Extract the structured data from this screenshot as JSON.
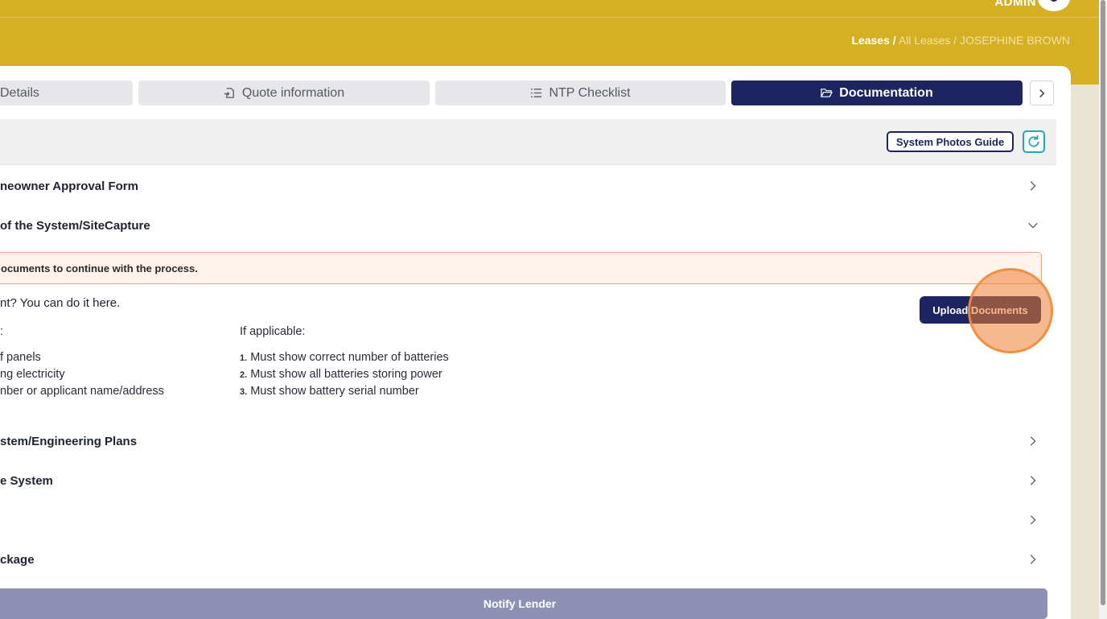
{
  "header": {
    "user_label": "ADMIN",
    "breadcrumb": {
      "root": "Leases /",
      "middle": "All Leases /",
      "current": "JOSEPHINE BROWN"
    }
  },
  "tabs": [
    {
      "label": "Details",
      "icon": "details-icon",
      "active": false
    },
    {
      "label": "Quote information",
      "icon": "file-import-icon",
      "active": false
    },
    {
      "label": "NTP Checklist",
      "icon": "list-icon",
      "active": false
    },
    {
      "label": "Documentation",
      "icon": "folder-open-icon",
      "active": true
    }
  ],
  "toolbar": {
    "photos_guide_label": "System Photos Guide",
    "refresh_icon": "refresh-icon"
  },
  "sections": [
    {
      "label": "neowner Approval Form",
      "expanded": false
    },
    {
      "label": "of the System/SiteCapture",
      "expanded": true
    },
    {
      "label": "stem/Engineering Plans",
      "expanded": false
    },
    {
      "label": "e System",
      "expanded": false
    },
    {
      "label": "",
      "expanded": false
    },
    {
      "label": "ckage",
      "expanded": false
    }
  ],
  "expanded_content": {
    "warning": "ocuments to continue with the process.",
    "upload_question": "nt? You can do it here.",
    "upload_button": "Upload Documents",
    "left_list": {
      "head": ":",
      "items": [
        "f panels",
        "ng electricity",
        "nber or applicant name/address"
      ]
    },
    "right_list": {
      "head": "If applicable:",
      "items": [
        {
          "num": "1.",
          "text": "Must show correct number of batteries"
        },
        {
          "num": "2.",
          "text": "Must show all batteries storing power"
        },
        {
          "num": "3.",
          "text": "Must show battery serial number"
        }
      ]
    }
  },
  "footer": {
    "notify_label": "Notify Lender"
  },
  "colors": {
    "brand_gold": "#d6b024",
    "navy": "#1c2560",
    "teal": "#26a5b8",
    "warning_border": "#f0a57a"
  }
}
